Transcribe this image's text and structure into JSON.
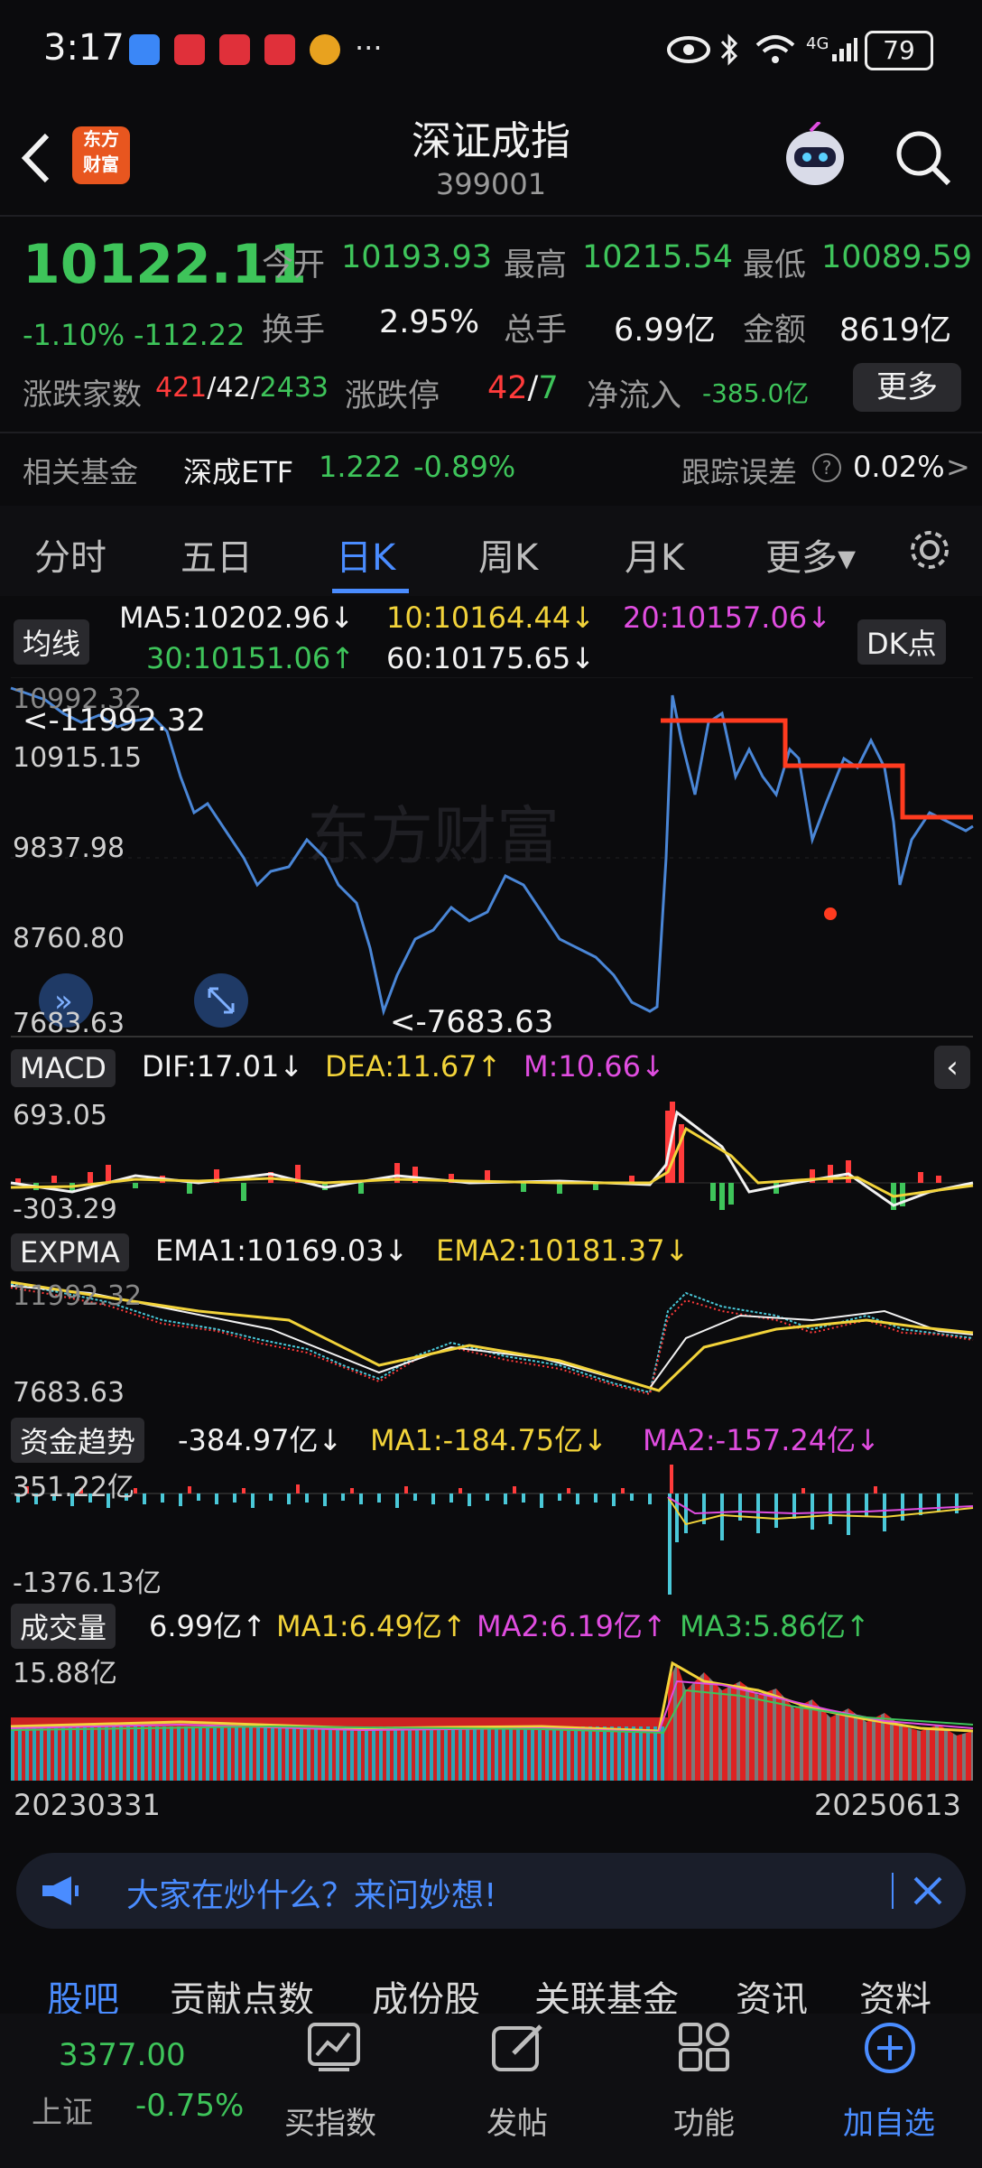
{
  "status": {
    "time": "3:17",
    "battery": "79",
    "net": "4G",
    "dots": "···"
  },
  "header": {
    "title": "深证成指",
    "code": "399001",
    "logo_line1": "东方",
    "logo_line2": "财富"
  },
  "quote": {
    "price": "10122.11",
    "change_pct": "-1.10%",
    "change": "-112.22",
    "open_label": "今开",
    "open": "10193.93",
    "high_label": "最高",
    "high": "10215.54",
    "low_label": "最低",
    "low": "10089.59",
    "turnover_label": "换手",
    "turnover": "2.95%",
    "volume_label": "总手",
    "volume": "6.99亿",
    "amount_label": "金额",
    "amount": "8619亿",
    "updown_label": "涨跌家数",
    "up_count": "421",
    "flat_count": "42",
    "down_count": "2433",
    "sep": "/",
    "limit_label": "涨跌停",
    "limit_up": "42",
    "limit_down": "7",
    "inflow_label": "净流入",
    "inflow": "-385.0亿",
    "more_btn": "更多"
  },
  "fund": {
    "label": "相关基金",
    "name": "深成ETF",
    "price": "1.222",
    "change": "-0.89%",
    "track_label": "跟踪误差",
    "track_value": "0.02%",
    "arrow": ">"
  },
  "tabs": [
    "分时",
    "五日",
    "日K",
    "周K",
    "月K",
    "更多▾"
  ],
  "active_tab": "日K",
  "ma": {
    "chip": "均线",
    "ma5": "MA5:10202.96↓",
    "ma10": "10:10164.44↓",
    "ma20": "20:10157.06↓",
    "ma30": "30:10151.06↑",
    "ma60": "60:10175.65↓",
    "dk_chip": "DK点"
  },
  "kline": {
    "y_labels": [
      "10992.32",
      "10915.15",
      "9837.98",
      "8760.80",
      "7683.63"
    ],
    "max_note": "<-11992.32",
    "min_note": "<-7683.63",
    "watermark": "东方财富"
  },
  "macd": {
    "chip": "MACD",
    "dif": "DIF:17.01↓",
    "dea": "DEA:11.67↑",
    "m": "M:10.66↓",
    "top": "693.05",
    "bottom": "-303.29"
  },
  "expma": {
    "chip": "EXPMA",
    "ema1": "EMA1:10169.03↓",
    "ema2": "EMA2:10181.37↓",
    "top": "11992.32",
    "bottom": "7683.63"
  },
  "fundflow": {
    "chip": "资金趋势",
    "value": "-384.97亿↓",
    "ma1": "MA1:-184.75亿↓",
    "ma2": "MA2:-157.24亿↓",
    "top": "351.22亿",
    "bottom": "-1376.13亿"
  },
  "volume": {
    "chip": "成交量",
    "value": "6.99亿↑",
    "ma1": "MA1:6.49亿↑",
    "ma2": "MA2:6.19亿↑",
    "ma3": "MA3:5.86亿↑",
    "top": "15.88亿"
  },
  "dates": {
    "start": "20230331",
    "end": "20250613"
  },
  "banner": {
    "text": "大家在炒什么？来问妙想!"
  },
  "subtabs": [
    "股吧",
    "贡献点数",
    "成份股",
    "关联基金",
    "资讯",
    "资料"
  ],
  "bottom": {
    "index_price": "3377.00",
    "index_name": "上证",
    "index_change": "-0.75%",
    "buy": "买指数",
    "post": "发帖",
    "func": "功能",
    "add": "加自选"
  },
  "colors": {
    "up": "#ff3b3b",
    "down": "#3ec45a",
    "accent": "#4a8cff",
    "brand": "#e8561f"
  }
}
